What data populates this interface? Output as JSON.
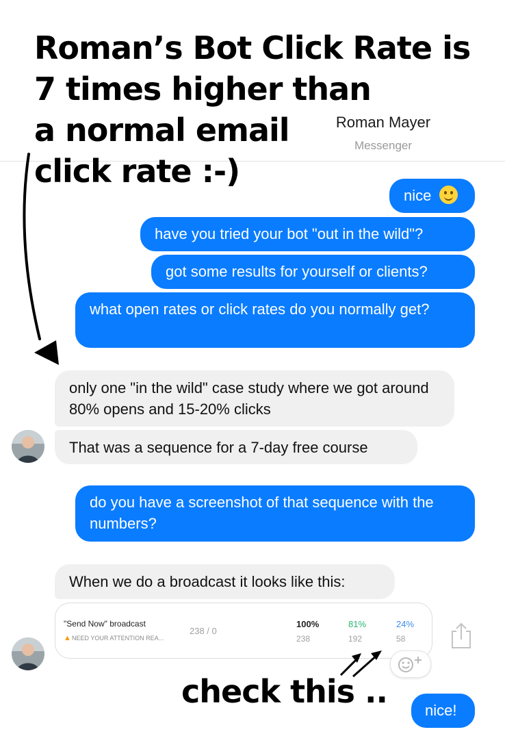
{
  "annotation": {
    "headline_lines": [
      "Roman’s Bot Click Rate is",
      "7 times higher than",
      "a normal email",
      "click rate :-)"
    ],
    "callout": "check this .."
  },
  "header": {
    "name": "Roman Mayer",
    "subtitle": "Messenger"
  },
  "messages": {
    "m1": {
      "text": "nice"
    },
    "m2": {
      "text": "have you tried your bot \"out in the wild\"?"
    },
    "m3": {
      "text": "got some results for yourself or clients?"
    },
    "m4": {
      "text": "what open rates or click rates do you normally get?"
    },
    "m5": {
      "text": "only one \"in the wild\" case study where we got around 80% opens and 15-20% clicks"
    },
    "m6": {
      "text": "That was a sequence for a 7-day free course"
    },
    "m7": {
      "text": "do you have a screenshot of that sequence with the numbers?"
    },
    "m8": {
      "text": "When we do a broadcast it looks like this:"
    },
    "m9": {
      "text": "nice!"
    }
  },
  "broadcast_card": {
    "title": "\"Send Now\" broadcast",
    "warning": "NEED YOUR ATTENTION REA...",
    "count": "238 / 0",
    "stats": [
      {
        "pct": "100%",
        "num": "238",
        "color": "#222222"
      },
      {
        "pct": "81%",
        "num": "192",
        "color": "#2bb673"
      },
      {
        "pct": "24%",
        "num": "58",
        "color": "#3d8ee8"
      }
    ]
  },
  "colors": {
    "outgoing_bubble": "#0a7cff",
    "incoming_bubble": "#f0f0f0"
  }
}
